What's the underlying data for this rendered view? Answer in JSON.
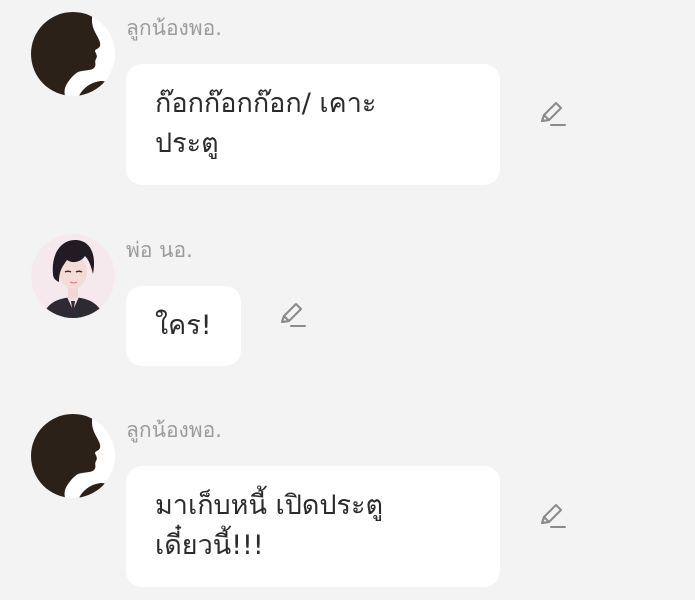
{
  "messages": [
    {
      "sender": "ลูกน้องพอ.",
      "text_lines": [
        "ก๊อกก๊อกก๊อก/ เคาะ",
        "ประตู"
      ],
      "avatar": "silhouette-avatar",
      "action_icon": "edit-pencil-icon"
    },
    {
      "sender": "พ่อ นอ.",
      "text_lines": [
        "ใคร!"
      ],
      "avatar": "anime-character-avatar",
      "action_icon": "edit-pencil-icon"
    },
    {
      "sender": "ลูกน้องพอ.",
      "text_lines": [
        "มาเก็บหนี้ เปิดประตู",
        "เดี๋ยวนี้!!!"
      ],
      "avatar": "silhouette-avatar",
      "action_icon": "edit-pencil-icon"
    }
  ],
  "colors": {
    "background": "#f3f3f3",
    "bubble": "#ffffff",
    "sender_text": "#9b9b9b",
    "message_text": "#2b2b2b",
    "icon": "#8a8a8a"
  }
}
